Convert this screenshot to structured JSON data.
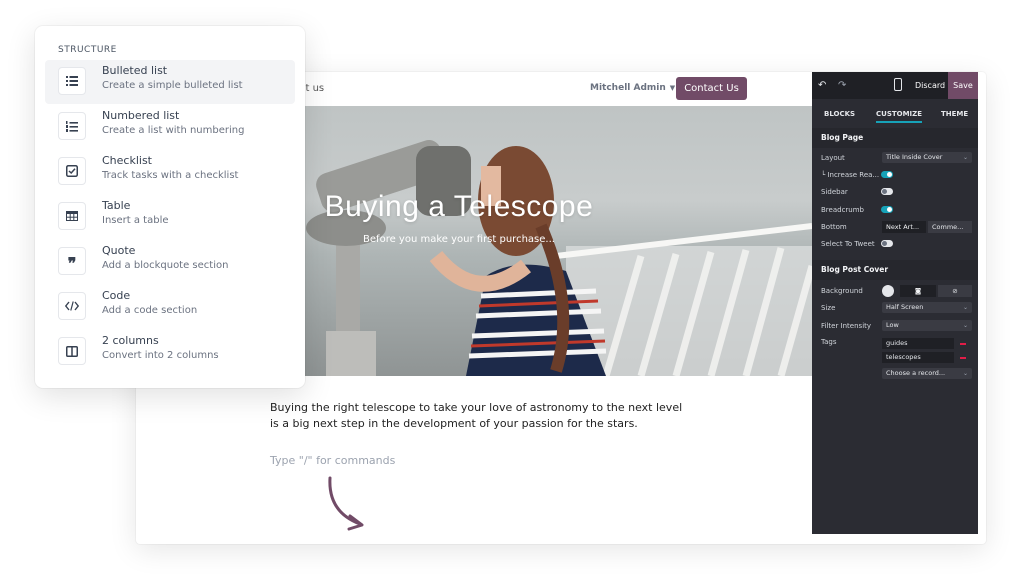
{
  "header": {
    "nav_fragment": "ct us",
    "admin_name": "Mitchell Admin",
    "contact_button": "Contact Us"
  },
  "hero": {
    "title": "Buying a Telescope",
    "subtitle": "Before you make your first purchase..."
  },
  "article": {
    "body": "Buying the right telescope to take your love of astronomy to the next level is a big next step in the development of your passion for the stars.",
    "placeholder": "Type \"/\" for commands"
  },
  "panel": {
    "discard": "Discard",
    "save": "Save",
    "tabs": [
      "BLOCKS",
      "CUSTOMIZE",
      "THEME"
    ],
    "blog_page": {
      "heading": "Blog Page",
      "layout_label": "Layout",
      "layout_value": "Title Inside Cover",
      "increase_label": "└ Increase Rea...",
      "increase_on": true,
      "sidebar_label": "Sidebar",
      "sidebar_on": false,
      "breadcrumb_label": "Breadcrumb",
      "breadcrumb_on": true,
      "bottom_label": "Bottom",
      "bottom_options": [
        "Next Art...",
        "Comme..."
      ],
      "tweet_label": "Select To Tweet",
      "tweet_on": false
    },
    "cover": {
      "heading": "Blog Post Cover",
      "background_label": "Background",
      "size_label": "Size",
      "size_value": "Half Screen",
      "filter_label": "Filter Intensity",
      "filter_value": "Low",
      "tags_label": "Tags",
      "tags": [
        "guides",
        "telescopes"
      ],
      "choose_record": "Choose a record..."
    }
  },
  "structure": {
    "title": "STRUCTURE",
    "items": [
      {
        "title": "Bulleted list",
        "desc": "Create a simple bulleted list",
        "icon": "bulleted-list-icon"
      },
      {
        "title": "Numbered list",
        "desc": "Create a list with numbering",
        "icon": "numbered-list-icon"
      },
      {
        "title": "Checklist",
        "desc": "Track tasks with a checklist",
        "icon": "checklist-icon"
      },
      {
        "title": "Table",
        "desc": "Insert a table",
        "icon": "table-icon"
      },
      {
        "title": "Quote",
        "desc": "Add a blockquote section",
        "icon": "quote-icon"
      },
      {
        "title": "Code",
        "desc": "Add a code section",
        "icon": "code-icon"
      },
      {
        "title": "2 columns",
        "desc": "Convert into 2 columns",
        "icon": "columns-icon"
      }
    ]
  },
  "colors": {
    "brand": "#714b67",
    "toggle_on": "#17a2b8",
    "panel_bg": "#2b2c33"
  }
}
